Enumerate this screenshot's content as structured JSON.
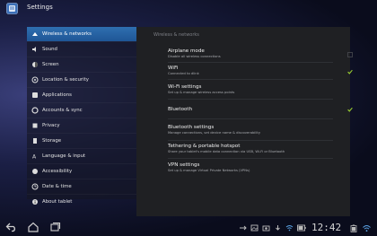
{
  "app": {
    "title": "Settings"
  },
  "sidebar": {
    "items": [
      {
        "label": "Wireless & networks",
        "icon": "wifi-icon",
        "selected": true
      },
      {
        "label": "Sound",
        "icon": "speaker-icon"
      },
      {
        "label": "Screen",
        "icon": "screen-icon"
      },
      {
        "label": "Location & security",
        "icon": "location-icon"
      },
      {
        "label": "Applications",
        "icon": "applications-icon"
      },
      {
        "label": "Accounts & sync",
        "icon": "sync-icon"
      },
      {
        "label": "Privacy",
        "icon": "privacy-icon"
      },
      {
        "label": "Storage",
        "icon": "storage-icon"
      },
      {
        "label": "Language & input",
        "icon": "language-icon"
      },
      {
        "label": "Accessibility",
        "icon": "accessibility-icon"
      },
      {
        "label": "Date & time",
        "icon": "clock-icon"
      },
      {
        "label": "About tablet",
        "icon": "info-icon"
      }
    ]
  },
  "panel": {
    "header": "Wireless & networks",
    "rows": [
      {
        "title": "Airplane mode",
        "subtitle": "Disable all wireless connections",
        "checkbox": true,
        "checked": false
      },
      {
        "title": "WiFi",
        "subtitle": "Connected to dlink",
        "checkbox": true,
        "checked": true
      },
      {
        "title": "Wi-Fi settings",
        "subtitle": "Set up & manage wireless access points"
      },
      {
        "title": "Bluetooth",
        "subtitle": "",
        "checkbox": true,
        "checked": true
      },
      {
        "title": "Bluetooth settings",
        "subtitle": "Manage connections, set device name & discoverability"
      },
      {
        "title": "Tethering & portable hotspot",
        "subtitle": "Share your tablet's mobile data connection via USB, Wi-Fi or Bluetooth"
      },
      {
        "title": "VPN settings",
        "subtitle": "Set up & manage Virtual Private Networks (VPNs)"
      }
    ]
  },
  "status": {
    "time": "12:42"
  },
  "colors": {
    "accent": "#2f6fb0",
    "check": "#9acd32",
    "panel": "#1f2023"
  }
}
